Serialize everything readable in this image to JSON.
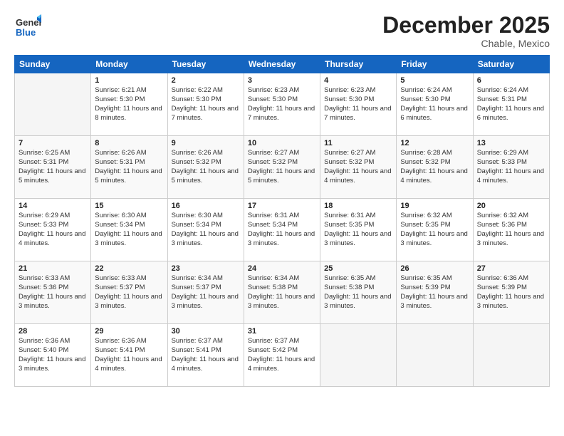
{
  "logo": {
    "line1": "General",
    "line2": "Blue"
  },
  "title": "December 2025",
  "subtitle": "Chable, Mexico",
  "days_of_week": [
    "Sunday",
    "Monday",
    "Tuesday",
    "Wednesday",
    "Thursday",
    "Friday",
    "Saturday"
  ],
  "weeks": [
    [
      {
        "day": "",
        "sunrise": "",
        "sunset": "",
        "daylight": ""
      },
      {
        "day": "1",
        "sunrise": "Sunrise: 6:21 AM",
        "sunset": "Sunset: 5:30 PM",
        "daylight": "Daylight: 11 hours and 8 minutes."
      },
      {
        "day": "2",
        "sunrise": "Sunrise: 6:22 AM",
        "sunset": "Sunset: 5:30 PM",
        "daylight": "Daylight: 11 hours and 7 minutes."
      },
      {
        "day": "3",
        "sunrise": "Sunrise: 6:23 AM",
        "sunset": "Sunset: 5:30 PM",
        "daylight": "Daylight: 11 hours and 7 minutes."
      },
      {
        "day": "4",
        "sunrise": "Sunrise: 6:23 AM",
        "sunset": "Sunset: 5:30 PM",
        "daylight": "Daylight: 11 hours and 7 minutes."
      },
      {
        "day": "5",
        "sunrise": "Sunrise: 6:24 AM",
        "sunset": "Sunset: 5:30 PM",
        "daylight": "Daylight: 11 hours and 6 minutes."
      },
      {
        "day": "6",
        "sunrise": "Sunrise: 6:24 AM",
        "sunset": "Sunset: 5:31 PM",
        "daylight": "Daylight: 11 hours and 6 minutes."
      }
    ],
    [
      {
        "day": "7",
        "sunrise": "Sunrise: 6:25 AM",
        "sunset": "Sunset: 5:31 PM",
        "daylight": "Daylight: 11 hours and 5 minutes."
      },
      {
        "day": "8",
        "sunrise": "Sunrise: 6:26 AM",
        "sunset": "Sunset: 5:31 PM",
        "daylight": "Daylight: 11 hours and 5 minutes."
      },
      {
        "day": "9",
        "sunrise": "Sunrise: 6:26 AM",
        "sunset": "Sunset: 5:32 PM",
        "daylight": "Daylight: 11 hours and 5 minutes."
      },
      {
        "day": "10",
        "sunrise": "Sunrise: 6:27 AM",
        "sunset": "Sunset: 5:32 PM",
        "daylight": "Daylight: 11 hours and 5 minutes."
      },
      {
        "day": "11",
        "sunrise": "Sunrise: 6:27 AM",
        "sunset": "Sunset: 5:32 PM",
        "daylight": "Daylight: 11 hours and 4 minutes."
      },
      {
        "day": "12",
        "sunrise": "Sunrise: 6:28 AM",
        "sunset": "Sunset: 5:32 PM",
        "daylight": "Daylight: 11 hours and 4 minutes."
      },
      {
        "day": "13",
        "sunrise": "Sunrise: 6:29 AM",
        "sunset": "Sunset: 5:33 PM",
        "daylight": "Daylight: 11 hours and 4 minutes."
      }
    ],
    [
      {
        "day": "14",
        "sunrise": "Sunrise: 6:29 AM",
        "sunset": "Sunset: 5:33 PM",
        "daylight": "Daylight: 11 hours and 4 minutes."
      },
      {
        "day": "15",
        "sunrise": "Sunrise: 6:30 AM",
        "sunset": "Sunset: 5:34 PM",
        "daylight": "Daylight: 11 hours and 3 minutes."
      },
      {
        "day": "16",
        "sunrise": "Sunrise: 6:30 AM",
        "sunset": "Sunset: 5:34 PM",
        "daylight": "Daylight: 11 hours and 3 minutes."
      },
      {
        "day": "17",
        "sunrise": "Sunrise: 6:31 AM",
        "sunset": "Sunset: 5:34 PM",
        "daylight": "Daylight: 11 hours and 3 minutes."
      },
      {
        "day": "18",
        "sunrise": "Sunrise: 6:31 AM",
        "sunset": "Sunset: 5:35 PM",
        "daylight": "Daylight: 11 hours and 3 minutes."
      },
      {
        "day": "19",
        "sunrise": "Sunrise: 6:32 AM",
        "sunset": "Sunset: 5:35 PM",
        "daylight": "Daylight: 11 hours and 3 minutes."
      },
      {
        "day": "20",
        "sunrise": "Sunrise: 6:32 AM",
        "sunset": "Sunset: 5:36 PM",
        "daylight": "Daylight: 11 hours and 3 minutes."
      }
    ],
    [
      {
        "day": "21",
        "sunrise": "Sunrise: 6:33 AM",
        "sunset": "Sunset: 5:36 PM",
        "daylight": "Daylight: 11 hours and 3 minutes."
      },
      {
        "day": "22",
        "sunrise": "Sunrise: 6:33 AM",
        "sunset": "Sunset: 5:37 PM",
        "daylight": "Daylight: 11 hours and 3 minutes."
      },
      {
        "day": "23",
        "sunrise": "Sunrise: 6:34 AM",
        "sunset": "Sunset: 5:37 PM",
        "daylight": "Daylight: 11 hours and 3 minutes."
      },
      {
        "day": "24",
        "sunrise": "Sunrise: 6:34 AM",
        "sunset": "Sunset: 5:38 PM",
        "daylight": "Daylight: 11 hours and 3 minutes."
      },
      {
        "day": "25",
        "sunrise": "Sunrise: 6:35 AM",
        "sunset": "Sunset: 5:38 PM",
        "daylight": "Daylight: 11 hours and 3 minutes."
      },
      {
        "day": "26",
        "sunrise": "Sunrise: 6:35 AM",
        "sunset": "Sunset: 5:39 PM",
        "daylight": "Daylight: 11 hours and 3 minutes."
      },
      {
        "day": "27",
        "sunrise": "Sunrise: 6:36 AM",
        "sunset": "Sunset: 5:39 PM",
        "daylight": "Daylight: 11 hours and 3 minutes."
      }
    ],
    [
      {
        "day": "28",
        "sunrise": "Sunrise: 6:36 AM",
        "sunset": "Sunset: 5:40 PM",
        "daylight": "Daylight: 11 hours and 3 minutes."
      },
      {
        "day": "29",
        "sunrise": "Sunrise: 6:36 AM",
        "sunset": "Sunset: 5:41 PM",
        "daylight": "Daylight: 11 hours and 4 minutes."
      },
      {
        "day": "30",
        "sunrise": "Sunrise: 6:37 AM",
        "sunset": "Sunset: 5:41 PM",
        "daylight": "Daylight: 11 hours and 4 minutes."
      },
      {
        "day": "31",
        "sunrise": "Sunrise: 6:37 AM",
        "sunset": "Sunset: 5:42 PM",
        "daylight": "Daylight: 11 hours and 4 minutes."
      },
      {
        "day": "",
        "sunrise": "",
        "sunset": "",
        "daylight": ""
      },
      {
        "day": "",
        "sunrise": "",
        "sunset": "",
        "daylight": ""
      },
      {
        "day": "",
        "sunrise": "",
        "sunset": "",
        "daylight": ""
      }
    ]
  ]
}
